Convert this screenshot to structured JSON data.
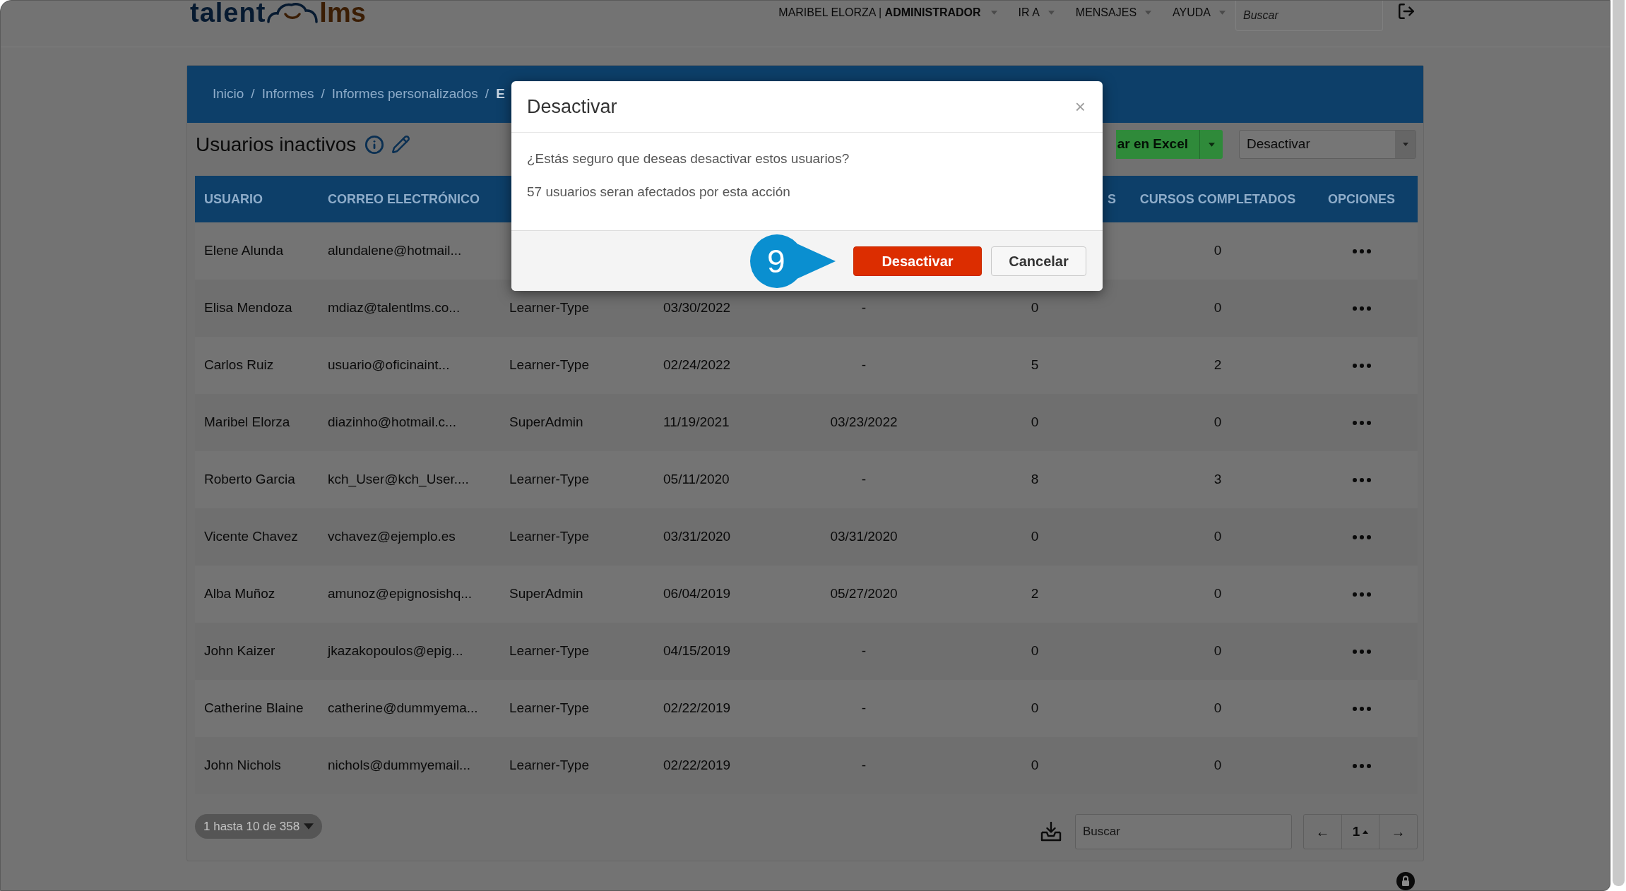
{
  "header": {
    "logo": {
      "left": "talent",
      "right": "lms"
    },
    "user_menu": "MARIBEL ELORZA | **ADMINISTRADOR**",
    "menus": [
      "IR A",
      "MENSAJES",
      "AYUDA"
    ],
    "search": {
      "placeholder": "Buscar"
    }
  },
  "breadcrumb": [
    {
      "label": "Inicio",
      "kind": "link"
    },
    {
      "label": "/",
      "kind": "separator"
    },
    {
      "label": "Informes",
      "kind": "link"
    },
    {
      "label": "/",
      "kind": "separator"
    },
    {
      "label": "Informes personalizados",
      "kind": "link"
    },
    {
      "label": "/",
      "kind": "separator"
    },
    {
      "label": "E",
      "kind": "current"
    }
  ],
  "report": {
    "title": "Usuarios inactivos",
    "export_button": "ar en Excel",
    "action_select": {
      "value": "Desactivar"
    }
  },
  "table": {
    "columns": [
      "USUARIO",
      "CORREO ELECTRÓNICO",
      null,
      null,
      null,
      "S",
      "CURSOS COMPLETADOS",
      "OPCIONES"
    ],
    "rows": [
      {
        "cells": [
          "Elene Alunda",
          "alundalene@hotmail...",
          null,
          null,
          null,
          null,
          "0"
        ]
      },
      {
        "cells": [
          "Elisa Mendoza",
          "mdiaz@talentlms.co...",
          "Learner-Type",
          "03/30/2022",
          "-",
          "0",
          "0"
        ]
      },
      {
        "cells": [
          "Carlos Ruiz",
          "usuario@oficinaint...",
          "Learner-Type",
          "02/24/2022",
          "-",
          "5",
          "2"
        ]
      },
      {
        "cells": [
          "Maribel Elorza",
          "diazinho@hotmail.c...",
          "SuperAdmin",
          "11/19/2021",
          "03/23/2022",
          "0",
          "0"
        ]
      },
      {
        "cells": [
          "Roberto Garcia",
          "kch_User@kch_User....",
          "Learner-Type",
          "05/11/2020",
          "-",
          "8",
          "3"
        ]
      },
      {
        "cells": [
          "Vicente Chavez",
          "vchavez@ejemplo.es",
          "Learner-Type",
          "03/31/2020",
          "03/31/2020",
          "0",
          "0"
        ]
      },
      {
        "cells": [
          "Alba Muñoz",
          "amunoz@epignosishq...",
          "SuperAdmin",
          "06/04/2019",
          "05/27/2020",
          "2",
          "0"
        ]
      },
      {
        "cells": [
          "John Kaizer",
          "jkazakopoulos@epig...",
          "Learner-Type",
          "04/15/2019",
          "-",
          "0",
          "0"
        ]
      },
      {
        "cells": [
          "Catherine Blaine",
          "catherine@dummyema...",
          "Learner-Type",
          "02/22/2019",
          "-",
          "0",
          "0"
        ]
      },
      {
        "cells": [
          "John Nichols",
          "nichols@dummyemail...",
          "Learner-Type",
          "02/22/2019",
          "-",
          "0",
          "0"
        ]
      }
    ]
  },
  "footer": {
    "range": "1 hasta 10 de 358",
    "search": {
      "placeholder": "Buscar"
    },
    "pagination": {
      "previous": "←",
      "page": "1",
      "next": "→"
    }
  },
  "dialog": {
    "title": "Desactivar",
    "close": "×",
    "lines": [
      "¿Estás seguro que deseas desactivar estos usuarios?",
      "57 usuarios seran afectados por esta acción"
    ],
    "step_marker": "9",
    "buttons": [
      {
        "label": "Desactivar",
        "kind": "primary"
      },
      {
        "label": "Cancelar",
        "kind": "secondary"
      }
    ]
  }
}
